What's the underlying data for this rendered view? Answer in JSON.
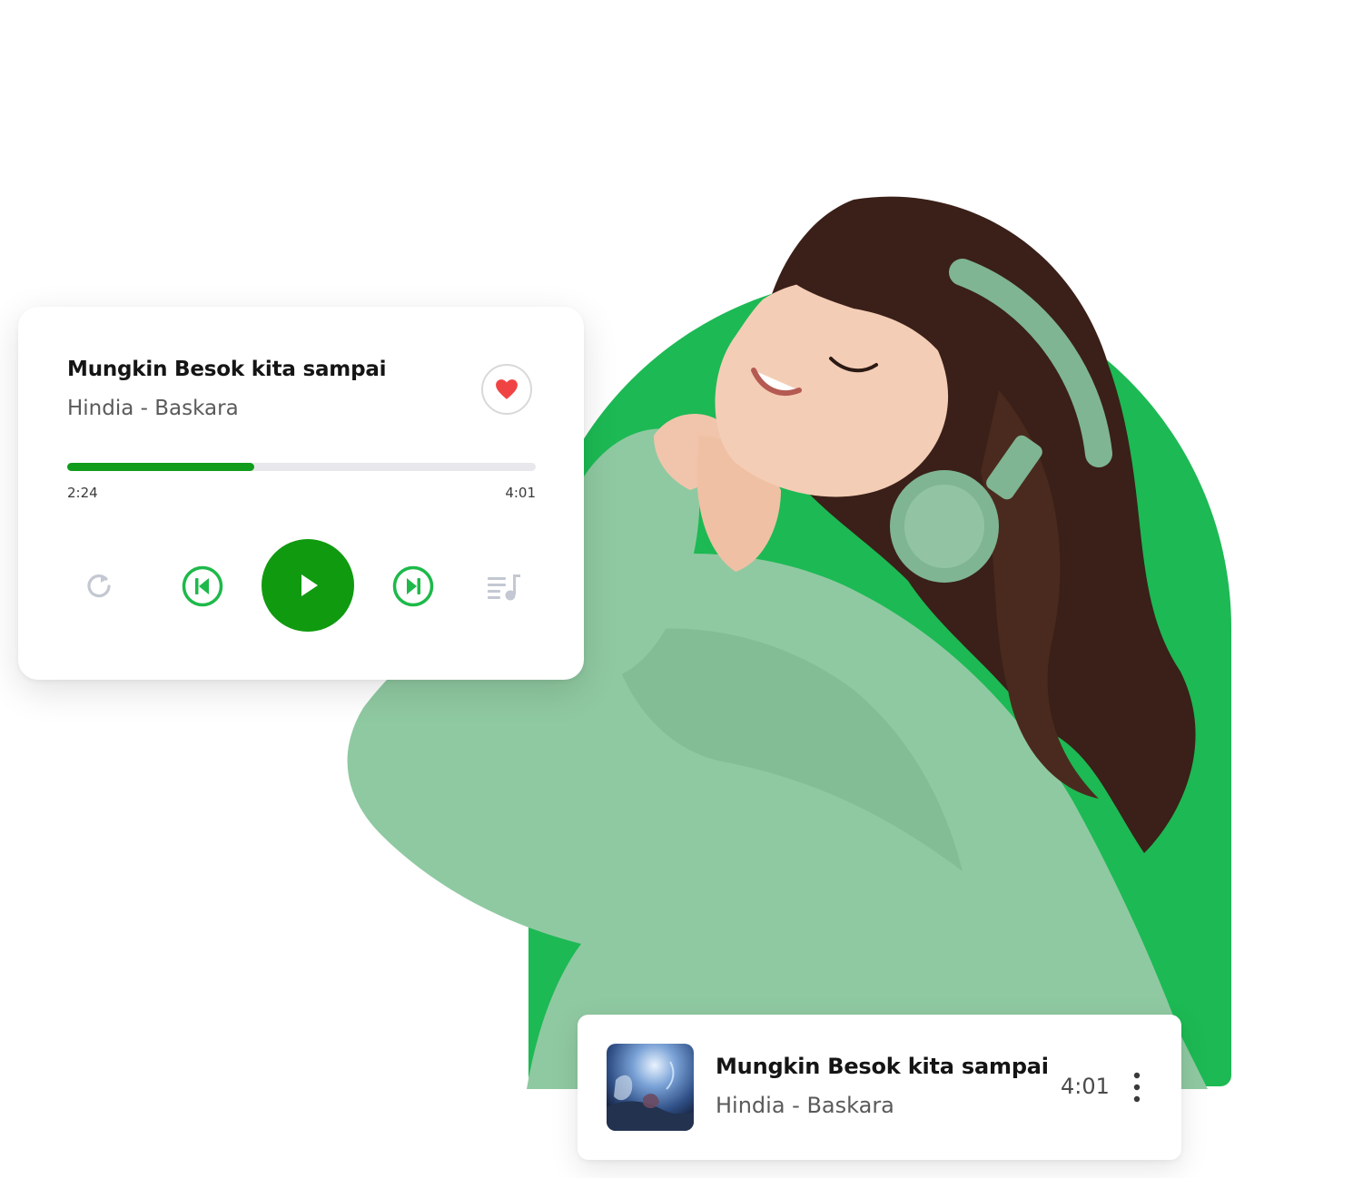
{
  "player": {
    "title": "Mungkin Besok kita sampai",
    "artist": "Hindia - Baskara",
    "elapsed": "2:24",
    "duration": "4:01",
    "progress": 0.4,
    "liked": true
  },
  "controls": {
    "repeat_icon": "repeat-icon",
    "prev_icon": "skip-previous-icon",
    "play_icon": "play-icon",
    "next_icon": "skip-next-icon",
    "queue_icon": "queue-music-icon"
  },
  "track_row": {
    "title": "Mungkin Besok kita sampai",
    "artist": "Hindia - Baskara",
    "duration": "4:01",
    "more_icon": "more-vertical-icon"
  },
  "colors": {
    "accent": "#1db954",
    "play": "#109a10",
    "progress": "#129c1c",
    "heart": "#f04444",
    "hoodie": "#8fc9a1",
    "hair": "#3a2018"
  }
}
